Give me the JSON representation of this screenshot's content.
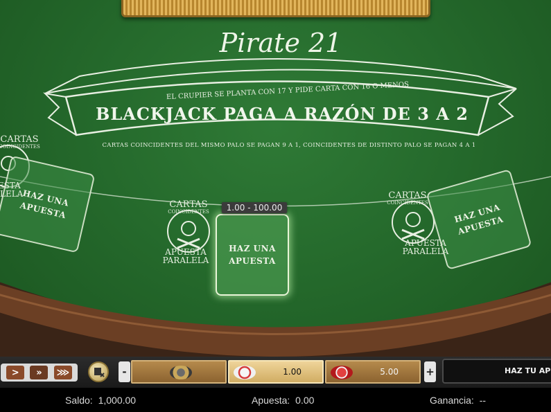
{
  "game": {
    "title": "Pirate 21",
    "banner_top": "EL CRUPIER SE PLANTA CON 17 Y PIDE CARTA CON 16 O MENOS",
    "banner_main": "BLACKJACK PAGA A RAZÓN DE 3 A 2",
    "banner_bottom": "CARTAS COINCIDENTES DEL MISMO PALO SE PAGAN 9 A 1, COINCIDENTES DE DISTINTO PALO SE PAGAN 4 A 1"
  },
  "bet_limits": "1.00 - 100.00",
  "spots": {
    "left": {
      "label_line1": "HAZ UNA",
      "label_line2": "APUESTA"
    },
    "center": {
      "label_line1": "HAZ UNA",
      "label_line2": "APUESTA"
    },
    "right": {
      "label_line1": "HAZ UNA",
      "label_line2": "APUESTA"
    }
  },
  "side_bets": {
    "left": {
      "top_line1": "CARTAS",
      "top_line2": "COINCIDENTES",
      "bottom_line1": "APUESTA",
      "bottom_line2": "PARALELA"
    },
    "center": {
      "top_line1": "CARTAS",
      "top_line2": "COINCIDENTES",
      "bottom_line1": "APUESTA",
      "bottom_line2": "PARALELA"
    },
    "right": {
      "top_line1": "CARTAS",
      "top_line2": "COINCIDENTES",
      "bottom_line1": "APUESTA",
      "bottom_line2": "PARALELA"
    }
  },
  "controls": {
    "speed_buttons": [
      ">",
      "»",
      "⋙"
    ],
    "minus": "-",
    "plus": "+",
    "chips": [
      {
        "value": "",
        "color": "#c9a75a"
      },
      {
        "value": "1.00",
        "color": "#e8e8e8"
      },
      {
        "value": "5.00",
        "color": "#c0282a"
      }
    ],
    "place_bet_label": "HAZ TU APUESTA"
  },
  "status": {
    "balance_label": "Saldo:",
    "balance_value": "1,000.00",
    "bet_label": "Apuesta:",
    "bet_value": "0.00",
    "win_label": "Ganancia:",
    "win_value": "--"
  },
  "colors": {
    "felt": "#256a2c",
    "accent_gold": "#d1ad63"
  }
}
